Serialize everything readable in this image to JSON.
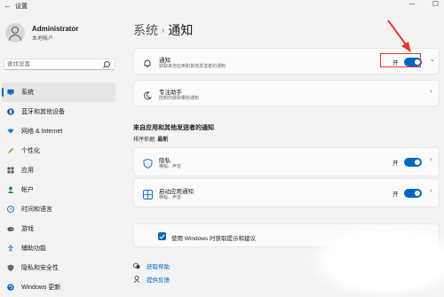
{
  "window": {
    "title": "设置",
    "back_glyph": "←",
    "min_glyph": "─",
    "max_glyph": "☐"
  },
  "profile": {
    "name": "Administrator",
    "account": "本地帐户"
  },
  "search": {
    "placeholder": "查找设置"
  },
  "nav": {
    "items": [
      {
        "label": "系统",
        "icon": "monitor-icon",
        "color": "#0067c0",
        "active": true
      },
      {
        "label": "蓝牙和其他设备",
        "icon": "bluetooth-icon",
        "color": "#0a5fb4"
      },
      {
        "label": "网络 & Internet",
        "icon": "wifi-icon",
        "color": "#1a73c9"
      },
      {
        "label": "个性化",
        "icon": "pen-icon",
        "color": "#c07a1c"
      },
      {
        "label": "应用",
        "icon": "apps-icon",
        "color": "#555555"
      },
      {
        "label": "帐户",
        "icon": "account-icon",
        "color": "#2f8f5b"
      },
      {
        "label": "时间和语言",
        "icon": "globe-icon",
        "color": "#2a7bc6"
      },
      {
        "label": "游戏",
        "icon": "gamepad-icon",
        "color": "#555555"
      },
      {
        "label": "辅助功能",
        "icon": "accessibility-icon",
        "color": "#2a6fb8"
      },
      {
        "label": "隐私和安全性",
        "icon": "shield-icon",
        "color": "#666666"
      },
      {
        "label": "Windows 更新",
        "icon": "update-icon",
        "color": "#0a66c2"
      }
    ]
  },
  "header": {
    "crumb": "系统",
    "separator": "›",
    "current": "通知"
  },
  "notifications_card": {
    "title": "通知",
    "desc": "获取来自应用和其他发送者的通知",
    "toggle_label": "开",
    "chevron": "⌄"
  },
  "focus_card": {
    "title": "专注助手",
    "desc": "控制你获取哪些通知",
    "chevron": "›"
  },
  "section": {
    "title": "来自应用和其他发送者的通知",
    "sort_label": "排序依据:",
    "sort_value": "最新"
  },
  "app_rows": [
    {
      "title": "隐私",
      "desc": "横幅、声音",
      "toggle_label": "开",
      "chevron": "›"
    },
    {
      "title": "启动应用通知",
      "desc": "横幅、声音",
      "toggle_label": "开",
      "chevron": "›"
    }
  ],
  "tips": {
    "checkbox_label": "使用 Windows 时获取提示和建议"
  },
  "links": {
    "help": "获取帮助",
    "feedback": "提供反馈"
  },
  "colors": {
    "accent": "#0067c0",
    "annotation": "#e53935"
  }
}
